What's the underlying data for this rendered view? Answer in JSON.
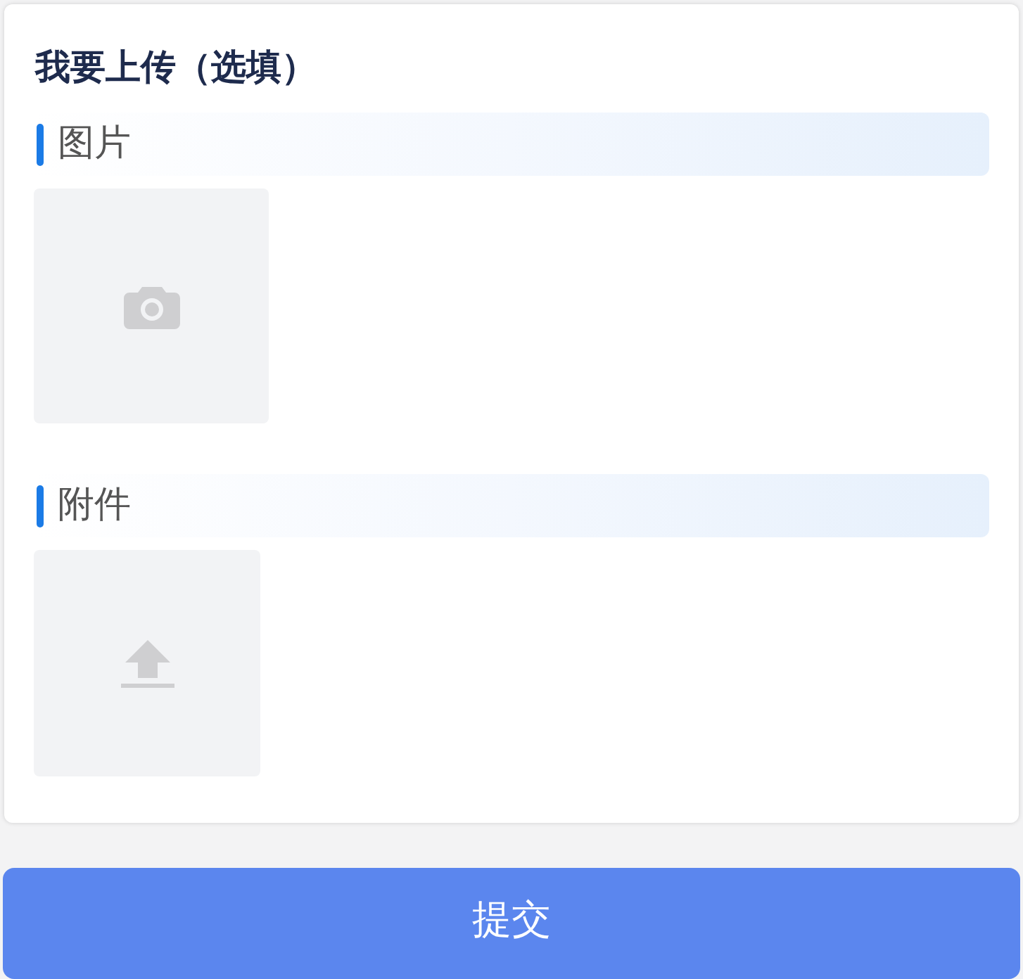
{
  "title": "我要上传（选填）",
  "sections": [
    {
      "label": "图片",
      "kind": "image"
    },
    {
      "label": "附件",
      "kind": "file"
    }
  ],
  "submit_button": "提交"
}
